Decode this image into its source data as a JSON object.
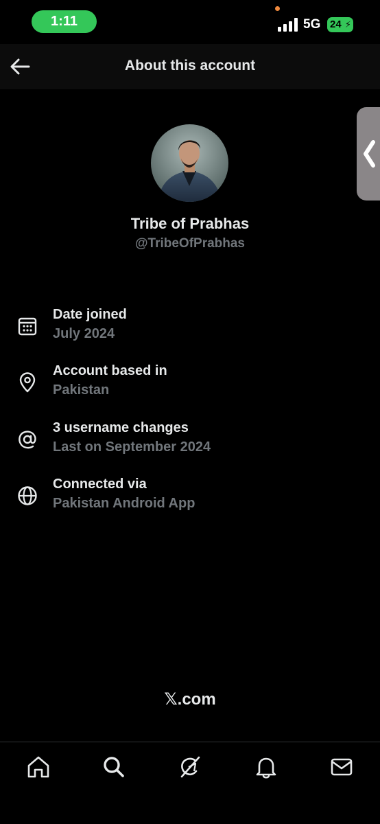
{
  "status_bar": {
    "time": "1:11",
    "network": "5G",
    "battery": "24"
  },
  "header": {
    "title": "About this account"
  },
  "profile": {
    "name": "Tribe of Prabhas",
    "handle": "@TribeOfPrabhas"
  },
  "info": [
    {
      "icon": "calendar-icon",
      "title": "Date joined",
      "value": "July 2024"
    },
    {
      "icon": "location-pin-icon",
      "title": "Account based in",
      "value": "Pakistan"
    },
    {
      "icon": "at-sign-icon",
      "title": "3 username changes",
      "value": "Last on September 2024"
    },
    {
      "icon": "globe-icon",
      "title": "Connected via",
      "value": "Pakistan Android App"
    }
  ],
  "footer": {
    "brand": "𝕏.com"
  },
  "bottom_nav": [
    "home-icon",
    "search-icon",
    "grok-icon",
    "notifications-bell-icon",
    "messages-envelope-icon"
  ],
  "colors": {
    "background": "#000000",
    "primary_text": "#e7e9ea",
    "secondary_text": "#71767b",
    "status_green": "#34c759"
  }
}
